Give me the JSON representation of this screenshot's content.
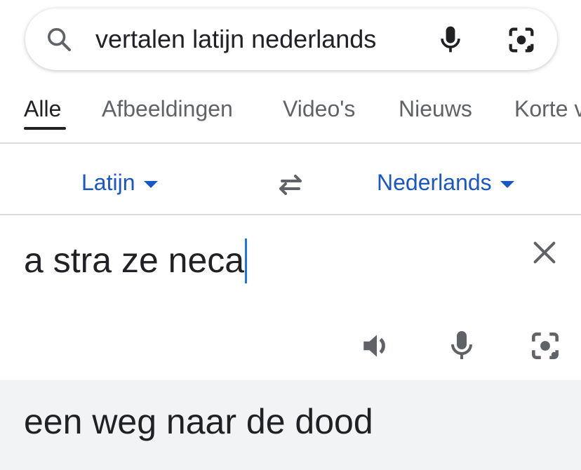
{
  "search": {
    "query": "vertalen latijn nederlands",
    "icons": [
      "search-icon",
      "mic-icon",
      "lens-icon"
    ]
  },
  "tabs": [
    {
      "label": "Alle",
      "active": true
    },
    {
      "label": "Afbeeldingen",
      "active": false
    },
    {
      "label": "Video's",
      "active": false
    },
    {
      "label": "Nieuws",
      "active": false
    },
    {
      "label": "Korte v",
      "active": false
    }
  ],
  "translator": {
    "source_language": "Latijn",
    "target_language": "Nederlands",
    "source_text": "a stra ze neca",
    "translated_text": "een weg naar de dood",
    "icons": [
      "swap-icon",
      "clear-icon",
      "speaker-icon",
      "mic-icon",
      "lens-icon"
    ]
  },
  "colors": {
    "accent": "#1a56c6",
    "cursor": "#1a73e8",
    "result_background": "#f1f3f4",
    "text": "#202124",
    "muted": "#5f6368"
  }
}
